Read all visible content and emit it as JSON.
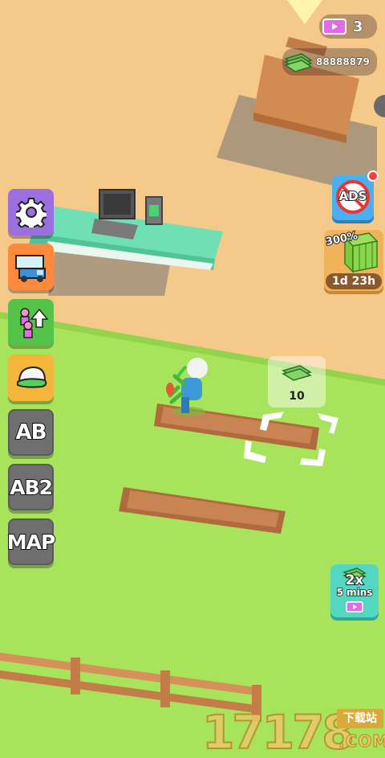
{
  "currency": {
    "tickets": "3",
    "cash": "88888879"
  },
  "side_menu": {
    "ab_label": "AB",
    "ab2_label": "AB2",
    "map_label": "MAP"
  },
  "right_panel": {
    "ads_label": "ADS",
    "boost_percent": "300%",
    "boost_timer": "1d 23h",
    "speed_multiplier": "2x",
    "speed_duration": "5 mins"
  },
  "build_slot": {
    "cost": "10"
  },
  "watermark": {
    "digits": "17178",
    "tag": "下载站",
    "domain": ".COM"
  },
  "colors": {
    "sand": "#f4c98a",
    "grass": "#a8e35c",
    "counter": "#6ee0b3",
    "settings_purple": "#9b6fe0",
    "orange_btn": "#ff8a3d",
    "green_btn": "#55c24a",
    "yellow_btn": "#f4b63a",
    "gray_btn": "#6f6f6f",
    "ads_blue": "#4ab0ee",
    "teal_btn": "#54d6c0",
    "dirt": "#b06a3e",
    "fence": "#d6905a"
  }
}
